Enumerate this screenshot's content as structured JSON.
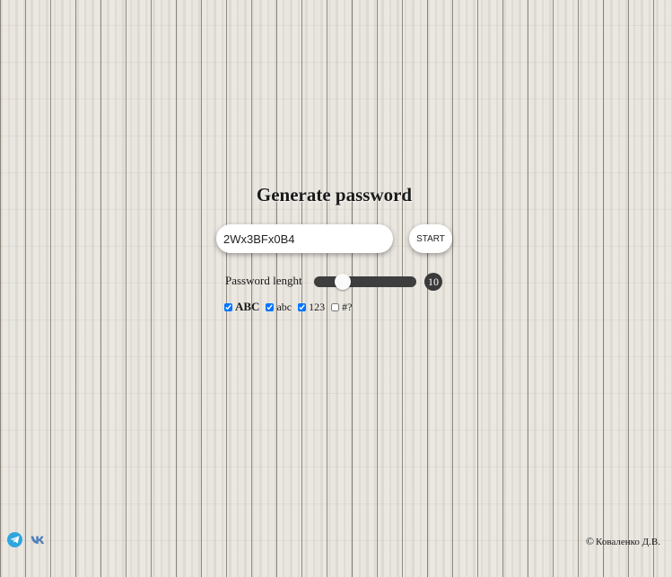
{
  "title": "Generate password",
  "password": {
    "value": "2Wx3BFx0B4"
  },
  "start_button": {
    "label": "START"
  },
  "length": {
    "label": "Password lenght",
    "value": "10",
    "slider_fraction": 0.28
  },
  "options": [
    {
      "label": "ABC",
      "checked": true
    },
    {
      "label": "abc",
      "checked": true
    },
    {
      "label": "123",
      "checked": true
    },
    {
      "label": "#?",
      "checked": false
    }
  ],
  "social": {
    "telegram_icon": "telegram-icon",
    "vk_icon": "vk-icon",
    "telegram_color": "#2ea6dd",
    "vk_color": "#5181b8"
  },
  "footer": {
    "copyright_symbol": "©",
    "author": "Коваленко Д.В."
  }
}
